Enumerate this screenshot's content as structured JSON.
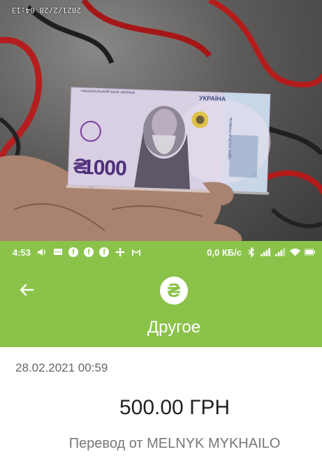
{
  "photo": {
    "timestamp": "2021/2/28 04:13",
    "banknote": {
      "bank_name": "НАЦІОНАЛЬНИЙ БАНК УКРАЇНИ",
      "country": "УКРАЇНА",
      "denomination": "1000",
      "currency_symbol": "₴",
      "words": "ОДНА ТИСЯЧА ГРИВЕНЬ"
    }
  },
  "status_bar": {
    "time": "4:53",
    "network_speed": "0,0 КБ/с"
  },
  "app_bar": {
    "back_icon": "arrow-left-icon",
    "category_icon": "hryvnia-icon",
    "category_symbol": "₴",
    "title": "Другое"
  },
  "transaction": {
    "datetime": "28.02.2021 00:59",
    "amount": "500.00 ГРН",
    "description": "Перевод от MELNYK MYKHAILO"
  },
  "colors": {
    "accent": "#8bc34a"
  }
}
